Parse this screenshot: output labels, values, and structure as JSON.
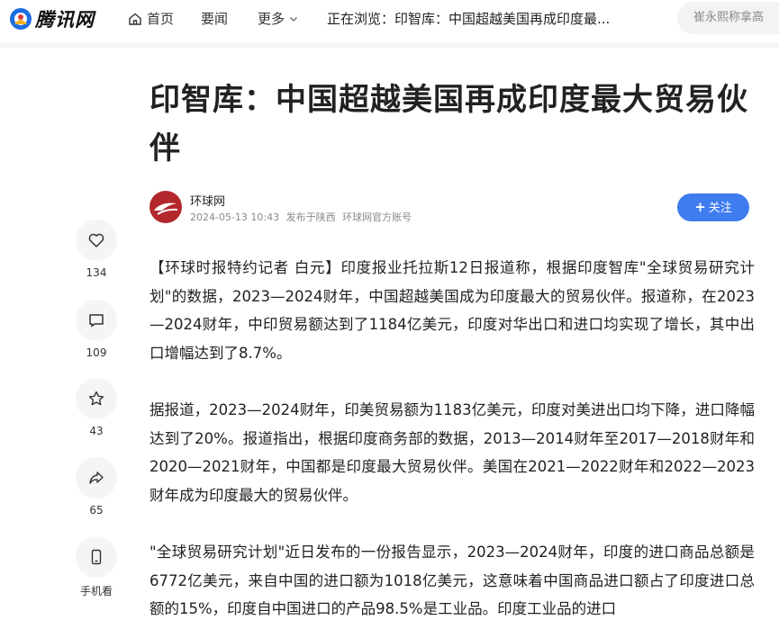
{
  "header": {
    "logo_text": "腾讯网",
    "nav": {
      "home": "首页",
      "news": "要闻",
      "more": "更多",
      "current": "正在浏览：印智库：中国超越美国再成印度最..."
    },
    "search_placeholder": "崔永熙称拿高"
  },
  "article": {
    "title": "印智库：中国超越美国再成印度最大贸易伙伴",
    "author": {
      "name": "环球网",
      "date": "2024-05-13 10:43",
      "location": "发布于陕西",
      "account": "环球网官方账号"
    },
    "follow_label": "关注",
    "paragraphs": [
      "【环球时报特约记者 白元】印度报业托拉斯12日报道称，根据印度智库\"全球贸易研究计划\"的数据，2023—2024财年，中国超越美国成为印度最大的贸易伙伴。报道称，在2023—2024财年，中印贸易额达到了1184亿美元，印度对华出口和进口均实现了增长，其中出口增幅达到了8.7%。",
      "据报道，2023—2024财年，印美贸易额为1183亿美元，印度对美进出口均下降，进口降幅达到了20%。报道指出，根据印度商务部的数据，2013—2014财年至2017—2018财年和2020—2021财年，中国都是印度最大贸易伙伴。美国在2021—2022财年和2022—2023财年成为印度最大的贸易伙伴。",
      "\"全球贸易研究计划\"近日发布的一份报告显示，2023—2024财年，印度的进口商品总额是6772亿美元，来自中国的进口额为1018亿美元，这意味着中国商品进口额占了印度进口总额的15%，印度自中国进口的产品98.5%是工业品。印度工业品的进口"
    ]
  },
  "side_actions": {
    "like_count": "134",
    "comment_count": "109",
    "favorite_count": "43",
    "share_count": "65",
    "mobile_label": "手机看"
  },
  "colors": {
    "accent": "#3e7cf0",
    "avatar": "#b3282d",
    "side_bg": "#f4f5f7"
  }
}
